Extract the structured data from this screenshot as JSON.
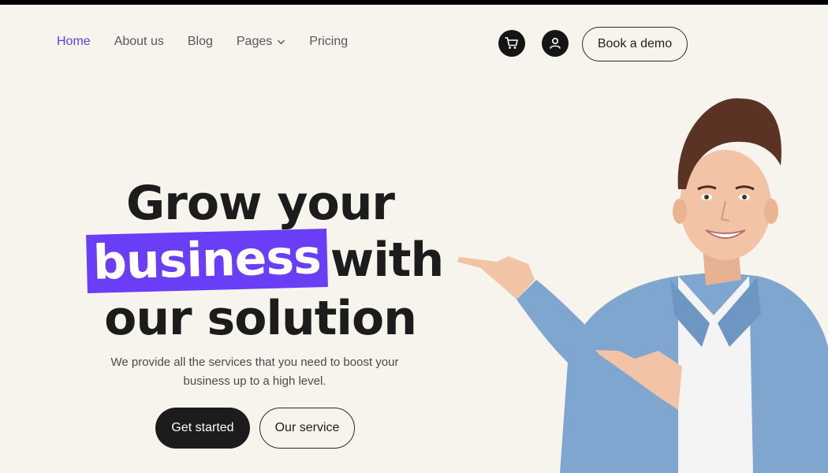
{
  "nav": {
    "items": [
      {
        "label": "Home",
        "active": true
      },
      {
        "label": "About us"
      },
      {
        "label": "Blog"
      },
      {
        "label": "Pages",
        "has_dropdown": true
      },
      {
        "label": "Pricing"
      }
    ],
    "icons": [
      "cart-icon",
      "user-icon"
    ],
    "cta": "Book a demo"
  },
  "hero": {
    "line1": "Grow your",
    "highlight": "business",
    "line2_rest": "with",
    "line3": "our solution",
    "subtitle": "We provide all the services that you need to boost your business up to a high level.",
    "primary_button": "Get started",
    "secondary_button": "Our service"
  },
  "colors": {
    "accent": "#6a3df6",
    "nav_active": "#5b3df5",
    "background": "#f7f4ee",
    "dark": "#1c1c1c"
  }
}
